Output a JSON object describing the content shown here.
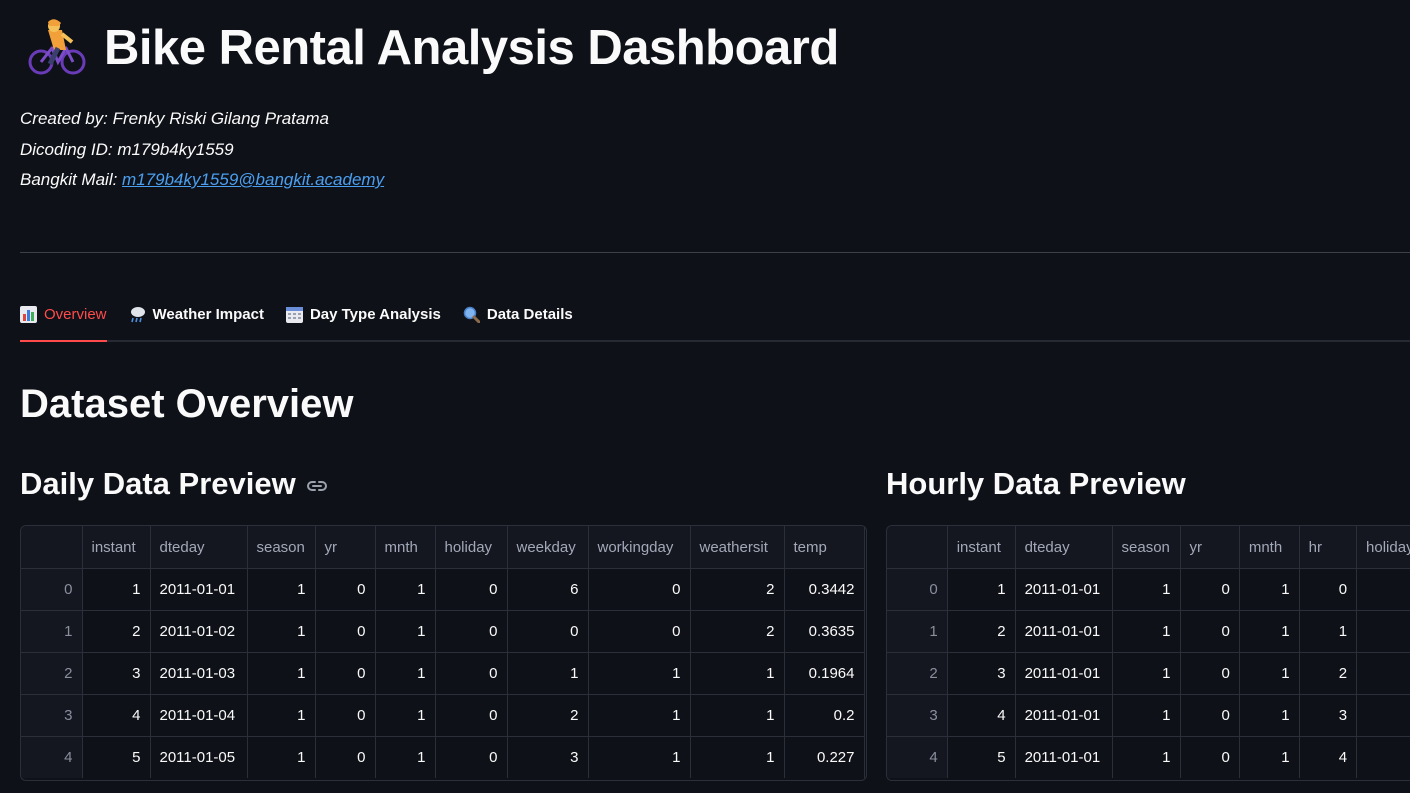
{
  "header": {
    "title": "Bike Rental Analysis Dashboard",
    "icon": "person-biking-icon"
  },
  "meta": {
    "created_by": "Created by: Frenky Riski Gilang Pratama",
    "dicoding_id": "Dicoding ID: m179b4ky1559",
    "mail_label": "Bangkit Mail: ",
    "mail_link": "m179b4ky1559@bangkit.academy"
  },
  "tabs": [
    {
      "label": "Overview",
      "icon": "bar-chart-icon",
      "active": true
    },
    {
      "label": "Weather Impact",
      "icon": "rain-cloud-icon",
      "active": false
    },
    {
      "label": "Day Type Analysis",
      "icon": "calendar-icon",
      "active": false
    },
    {
      "label": "Data Details",
      "icon": "magnifier-icon",
      "active": false
    }
  ],
  "section_title": "Dataset Overview",
  "daily": {
    "title": "Daily Data Preview",
    "columns": [
      "",
      "instant",
      "dteday",
      "season",
      "yr",
      "mnth",
      "holiday",
      "weekday",
      "workingday",
      "weathersit",
      "temp"
    ],
    "rows": [
      [
        "0",
        "1",
        "2011-01-01",
        "1",
        "0",
        "1",
        "0",
        "6",
        "0",
        "2",
        "0.3442"
      ],
      [
        "1",
        "2",
        "2011-01-02",
        "1",
        "0",
        "1",
        "0",
        "0",
        "0",
        "2",
        "0.3635"
      ],
      [
        "2",
        "3",
        "2011-01-03",
        "1",
        "0",
        "1",
        "0",
        "1",
        "1",
        "1",
        "0.1964"
      ],
      [
        "3",
        "4",
        "2011-01-04",
        "1",
        "0",
        "1",
        "0",
        "2",
        "1",
        "1",
        "0.2"
      ],
      [
        "4",
        "5",
        "2011-01-05",
        "1",
        "0",
        "1",
        "0",
        "3",
        "1",
        "1",
        "0.227"
      ]
    ]
  },
  "hourly": {
    "title": "Hourly Data Preview",
    "columns": [
      "",
      "instant",
      "dteday",
      "season",
      "yr",
      "mnth",
      "hr",
      "holiday"
    ],
    "rows": [
      [
        "0",
        "1",
        "2011-01-01",
        "1",
        "0",
        "1",
        "0",
        ""
      ],
      [
        "1",
        "2",
        "2011-01-01",
        "1",
        "0",
        "1",
        "1",
        ""
      ],
      [
        "2",
        "3",
        "2011-01-01",
        "1",
        "0",
        "1",
        "2",
        ""
      ],
      [
        "3",
        "4",
        "2011-01-01",
        "1",
        "0",
        "1",
        "3",
        ""
      ],
      [
        "4",
        "5",
        "2011-01-01",
        "1",
        "0",
        "1",
        "4",
        ""
      ]
    ]
  },
  "colors": {
    "background": "#0e1117",
    "accent": "#ff4b4b",
    "link": "#4b9ff0"
  }
}
